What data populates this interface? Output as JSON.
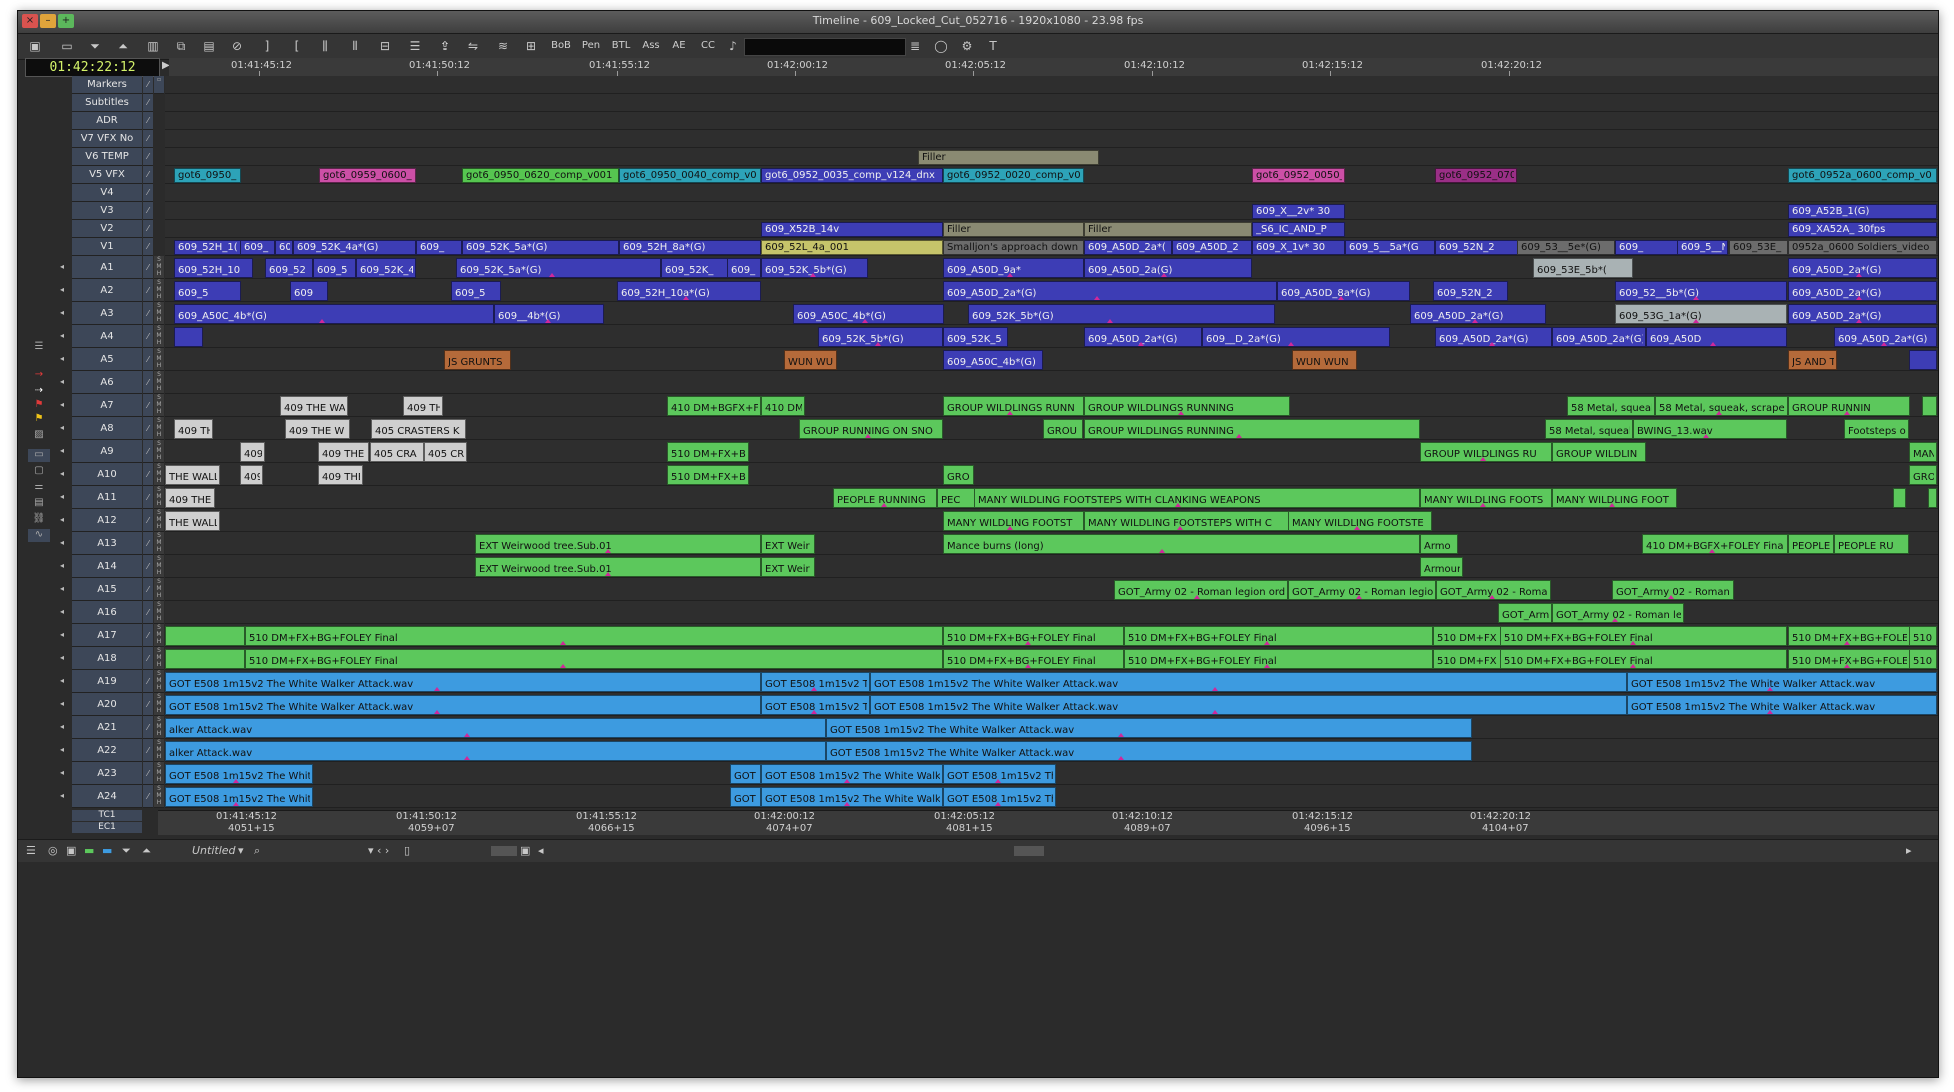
{
  "window": {
    "title": "Timeline - 609_Locked_Cut_052716 - 1920x1080 - 23.98 fps"
  },
  "toolbar": {
    "buttons": [
      "BoB",
      "Pen",
      "BTL",
      "Ass",
      "AE",
      "CC"
    ]
  },
  "timecode": "01:42:22:12",
  "ruler": {
    "labels": [
      "01:41:45:12",
      "01:41:50:12",
      "01:41:55:12",
      "01:42:00:12",
      "01:42:05:12",
      "01:42:10:12",
      "01:42:15:12",
      "01:42:20:12"
    ]
  },
  "bottom_ruler": {
    "tc1_label": "TC1",
    "ec1_label": "EC1",
    "tc1": [
      "01:41:45:12",
      "01:41:50:12",
      "01:41:55:12",
      "01:42:00:12",
      "01:42:05:12",
      "01:42:10:12",
      "01:42:15:12",
      "01:42:20:12"
    ],
    "ec1": [
      "4051+15",
      "4059+07",
      "4066+15",
      "4074+07",
      "4081+15",
      "4089+07",
      "4096+15",
      "4104+07"
    ]
  },
  "tracks": [
    {
      "name": "Markers",
      "clips": []
    },
    {
      "name": "Subtitles",
      "clips": []
    },
    {
      "name": "ADR",
      "clips": []
    },
    {
      "name": "V7 VFX No",
      "clips": []
    },
    {
      "name": "V6 TEMP",
      "clips": [
        {
          "label": "Filler",
          "kind": "cf"
        }
      ]
    },
    {
      "name": "V5 VFX",
      "clips": [
        {
          "label": "got6_0950_",
          "kind": "ct"
        },
        {
          "label": "got6_0959_0600_",
          "kind": "cm"
        },
        {
          "label": "got6_0950_0620_comp_v001",
          "kind": "clg"
        },
        {
          "label": "got6_0950_0040_comp_v0",
          "kind": "ct"
        },
        {
          "label": "got6_0952_0035_comp_v124_dnx",
          "kind": "cv"
        },
        {
          "label": "got6_0952_0020_comp_v0",
          "kind": "ct"
        },
        {
          "label": "got6_0952_0050_",
          "kind": "cm"
        },
        {
          "label": "got6_0952_070",
          "kind": "cp"
        },
        {
          "label": "got6_0952a_0600_comp_v0",
          "kind": "ct"
        }
      ]
    },
    {
      "name": "V4",
      "clips": []
    },
    {
      "name": "V3",
      "clips": [
        {
          "label": "609_X__2v* 30",
          "kind": "cv"
        },
        {
          "label": "609_A52B_1(G)",
          "kind": "cv"
        }
      ]
    },
    {
      "name": "V2",
      "clips": [
        {
          "label": "609_X52B_14v",
          "kind": "cv"
        },
        {
          "label": "Filler",
          "kind": "cf"
        },
        {
          "label": "Filler",
          "kind": "cf"
        },
        {
          "label": "_S6_IC_AND_P",
          "kind": "cv"
        },
        {
          "label": "609_XA52A_ 30fps",
          "kind": "cv"
        }
      ]
    },
    {
      "name": "V1",
      "clips": [
        {
          "label": "609_52H_1(",
          "kind": "cv"
        },
        {
          "label": "609_",
          "kind": "cv"
        },
        {
          "label": "60",
          "kind": "cv"
        },
        {
          "label": "609_52K_4a*(G)",
          "kind": "cv"
        },
        {
          "label": "609_",
          "kind": "cv"
        },
        {
          "label": "609_52K_5a*(G)",
          "kind": "cv"
        },
        {
          "label": "609_52H_8a*(G)",
          "kind": "cv"
        },
        {
          "label": "609_52L_4a_001",
          "kind": "cy"
        },
        {
          "label": "Smalljon's approach down",
          "kind": "cgr"
        },
        {
          "label": "609_A50D_2a*(",
          "kind": "cv"
        },
        {
          "label": "609_A50D_2",
          "kind": "cv"
        },
        {
          "label": "609_X_1v* 30",
          "kind": "cv"
        },
        {
          "label": "609_5__5a*(G",
          "kind": "cv"
        },
        {
          "label": "609_52N_2",
          "kind": "cv"
        },
        {
          "label": "609_53__5e*(G)",
          "kind": "cgr"
        },
        {
          "label": "609_",
          "kind": "cv"
        },
        {
          "label": "609_5__N",
          "kind": "cv"
        },
        {
          "label": "609_53E_",
          "kind": "cgr"
        },
        {
          "label": "0952a_0600 Soldiers_video",
          "kind": "cgr"
        }
      ]
    },
    {
      "name": "A1",
      "clips": [
        {
          "label": "609_52H_10",
          "kind": "cv"
        },
        {
          "label": "609_52",
          "kind": "cv"
        },
        {
          "label": "609_5",
          "kind": "cv"
        },
        {
          "label": "609_52K_4",
          "kind": "cv"
        },
        {
          "label": "609_52K_5a*(G)",
          "kind": "cv"
        },
        {
          "label": "609_52K_",
          "kind": "cv"
        },
        {
          "label": "609_",
          "kind": "cv"
        },
        {
          "label": "609_52K_5b*(G)",
          "kind": "cv"
        },
        {
          "label": "609_A50D_9a*",
          "kind": "cv"
        },
        {
          "label": "609_A50D_2a(G)",
          "kind": "cv"
        },
        {
          "label": "609_53E_5b*(",
          "kind": "cbg"
        },
        {
          "label": "609_A50D_2a*(G)",
          "kind": "cv"
        }
      ]
    },
    {
      "name": "A2",
      "clips": [
        {
          "label": "609_5",
          "kind": "cv"
        },
        {
          "label": "609",
          "kind": "cv"
        },
        {
          "label": "609_5",
          "kind": "cv"
        },
        {
          "label": "609_52H_10a*(G)",
          "kind": "cv"
        },
        {
          "label": "609_A50D_2a*(G)",
          "kind": "cv"
        },
        {
          "label": "609_A50D_8a*(G)",
          "kind": "cv"
        },
        {
          "label": "609_52N_2",
          "kind": "cv"
        },
        {
          "label": "609_52__5b*(G)",
          "kind": "cv"
        },
        {
          "label": "609_A50D_2a*(G)",
          "kind": "cv"
        }
      ]
    },
    {
      "name": "A3",
      "clips": [
        {
          "label": "609_A50C_4b*(G)",
          "kind": "cv"
        },
        {
          "label": "609__4b*(G)",
          "kind": "cv"
        },
        {
          "label": "609_A50C_4b*(G)",
          "kind": "cv"
        },
        {
          "label": "609_52K_5b*(G)",
          "kind": "cv"
        },
        {
          "label": "609_A50D_2a*(G)",
          "kind": "cv"
        },
        {
          "label": "609_53G_1a*(G)",
          "kind": "cbg"
        },
        {
          "label": "609_A50D_2a*(G)",
          "kind": "cv"
        }
      ]
    },
    {
      "name": "A4",
      "clips": [
        {
          "label": "",
          "kind": "cv"
        },
        {
          "label": "609_52K_5b*(G)",
          "kind": "cv"
        },
        {
          "label": "609_52K_5",
          "kind": "cv"
        },
        {
          "label": "609_A50D_2a*(G)",
          "kind": "cv"
        },
        {
          "label": "609__D_2a*(G)",
          "kind": "cv"
        },
        {
          "label": "609_A50D_2a*(G)",
          "kind": "cv"
        },
        {
          "label": "609_A50D_2a*(G)",
          "kind": "cv"
        },
        {
          "label": "609_A50D",
          "kind": "cv"
        },
        {
          "label": "609_A50D_2a*(G)",
          "kind": "cv"
        }
      ]
    },
    {
      "name": "A5",
      "clips": [
        {
          "label": "JS GRUNTS",
          "kind": "co"
        },
        {
          "label": "WUN WU",
          "kind": "co"
        },
        {
          "label": "609_A50C_4b*(G)",
          "kind": "cv"
        },
        {
          "label": "WUN WUN",
          "kind": "co"
        },
        {
          "label": "JS AND T",
          "kind": "co"
        },
        {
          "label": "",
          "kind": "cv"
        }
      ]
    },
    {
      "name": "A6",
      "clips": []
    },
    {
      "name": "A7",
      "clips": [
        {
          "label": "409 THE WA",
          "kind": "cw"
        },
        {
          "label": "409 TH",
          "kind": "cw"
        },
        {
          "label": "410 DM+BGFX+FO",
          "kind": "cg"
        },
        {
          "label": "410 DM",
          "kind": "cg"
        },
        {
          "label": "GROUP WILDLINGS RUNN",
          "kind": "cg"
        },
        {
          "label": "GROUP WILDLINGS RUNNING",
          "kind": "cg"
        },
        {
          "label": "58 Metal, squeal",
          "kind": "cg"
        },
        {
          "label": "58 Metal, squeak, scrape",
          "kind": "cg"
        },
        {
          "label": "GROUP RUNNIN",
          "kind": "cg"
        },
        {
          "label": "",
          "kind": "cg"
        }
      ]
    },
    {
      "name": "A8",
      "clips": [
        {
          "label": "409 TH",
          "kind": "cw"
        },
        {
          "label": "409 THE W",
          "kind": "cw"
        },
        {
          "label": "405 CRASTERS K",
          "kind": "cw"
        },
        {
          "label": "GROUP RUNNING ON SNO",
          "kind": "cg"
        },
        {
          "label": "GROU",
          "kind": "cg"
        },
        {
          "label": "GROUP WILDLINGS RUNNING",
          "kind": "cg"
        },
        {
          "label": "58 Metal, squeak, sc",
          "kind": "cg"
        },
        {
          "label": "BWING_13.wav",
          "kind": "cg"
        },
        {
          "label": "Footsteps o",
          "kind": "cg"
        }
      ]
    },
    {
      "name": "A9",
      "clips": [
        {
          "label": "409",
          "kind": "cw"
        },
        {
          "label": "409 THE",
          "kind": "cw"
        },
        {
          "label": "405 CRA",
          "kind": "cw"
        },
        {
          "label": "405 CR",
          "kind": "cw"
        },
        {
          "label": "510 DM+FX+BG",
          "kind": "cg"
        },
        {
          "label": "GROUP WILDLINGS RU",
          "kind": "cg"
        },
        {
          "label": "GROUP WILDLIN",
          "kind": "cg"
        },
        {
          "label": "MAN",
          "kind": "cg"
        }
      ]
    },
    {
      "name": "A10",
      "clips": [
        {
          "label": "THE WALL",
          "kind": "cw"
        },
        {
          "label": "409",
          "kind": "cw"
        },
        {
          "label": "409 THE",
          "kind": "cw"
        },
        {
          "label": "510 DM+FX+BG",
          "kind": "cg"
        },
        {
          "label": "GRO",
          "kind": "cg"
        },
        {
          "label": "GRO",
          "kind": "cg"
        }
      ]
    },
    {
      "name": "A11",
      "clips": [
        {
          "label": "409 THE",
          "kind": "cw"
        },
        {
          "label": "PEOPLE RUNNING",
          "kind": "cg"
        },
        {
          "label": "PEC",
          "kind": "cg"
        },
        {
          "label": "MANY WILDLING FOOTSTEPS WITH CLANKING WEAPONS",
          "kind": "cg"
        },
        {
          "label": "MANY WILDLING FOOTS",
          "kind": "cg"
        },
        {
          "label": "MANY WILDLING FOOT",
          "kind": "cg"
        },
        {
          "label": "",
          "kind": "cg"
        },
        {
          "label": "",
          "kind": "cg"
        }
      ]
    },
    {
      "name": "A12",
      "clips": [
        {
          "label": "THE WALL",
          "kind": "cw"
        },
        {
          "label": "MANY WILDLING FOOTST",
          "kind": "cg"
        },
        {
          "label": "MANY WILDLING FOOTSTEPS WITH C",
          "kind": "cg"
        },
        {
          "label": "MANY WILDLING FOOTSTE",
          "kind": "cg"
        }
      ]
    },
    {
      "name": "A13",
      "clips": [
        {
          "label": "EXT Weirwood tree.Sub.01",
          "kind": "cg"
        },
        {
          "label": "EXT Weir",
          "kind": "cg"
        },
        {
          "label": "Mance burns (long)",
          "kind": "cg"
        },
        {
          "label": "Armo",
          "kind": "cg"
        },
        {
          "label": "410 DM+BGFX+FOLEY Fina",
          "kind": "cg"
        },
        {
          "label": "PEOPLE",
          "kind": "cg"
        },
        {
          "label": "PEOPLE RU",
          "kind": "cg"
        }
      ]
    },
    {
      "name": "A14",
      "clips": [
        {
          "label": "EXT Weirwood tree.Sub.01",
          "kind": "cg"
        },
        {
          "label": "EXT Weir",
          "kind": "cg"
        },
        {
          "label": "Armour",
          "kind": "cg"
        }
      ]
    },
    {
      "name": "A15",
      "clips": [
        {
          "label": "GOT_Army 02 - Roman legion ord",
          "kind": "cg"
        },
        {
          "label": "GOT_Army 02 - Roman legio",
          "kind": "cg"
        },
        {
          "label": "GOT_Army 02 - Roma",
          "kind": "cg"
        },
        {
          "label": "GOT_Army 02 - Roman",
          "kind": "cg"
        }
      ]
    },
    {
      "name": "A16",
      "clips": [
        {
          "label": "GOT_Arm",
          "kind": "cg"
        },
        {
          "label": "GOT_Army 02 - Roman le",
          "kind": "cg"
        }
      ]
    },
    {
      "name": "A17",
      "clips": [
        {
          "label": "",
          "kind": "cg"
        },
        {
          "label": "510 DM+FX+BG+FOLEY Final",
          "kind": "cg"
        },
        {
          "label": "510 DM+FX+BG+FOLEY Final",
          "kind": "cg"
        },
        {
          "label": "510 DM+FX+BG+FOLEY Final",
          "kind": "cg"
        },
        {
          "label": "510 DM+FX",
          "kind": "cg"
        },
        {
          "label": "510 DM+FX+BG+FOLEY Final",
          "kind": "cg"
        },
        {
          "label": "510 DM+FX+BG+FOLE",
          "kind": "cg"
        },
        {
          "label": "510",
          "kind": "cg"
        }
      ]
    },
    {
      "name": "A18",
      "clips": [
        {
          "label": "",
          "kind": "cg"
        },
        {
          "label": "510 DM+FX+BG+FOLEY Final",
          "kind": "cg"
        },
        {
          "label": "510 DM+FX+BG+FOLEY Final",
          "kind": "cg"
        },
        {
          "label": "510 DM+FX+BG+FOLEY Final",
          "kind": "cg"
        },
        {
          "label": "510 DM+FX",
          "kind": "cg"
        },
        {
          "label": "510 DM+FX+BG+FOLEY Final",
          "kind": "cg"
        },
        {
          "label": "510 DM+FX+BG+FOLE",
          "kind": "cg"
        },
        {
          "label": "510",
          "kind": "cg"
        }
      ]
    },
    {
      "name": "A19",
      "clips": [
        {
          "label": "GOT E508 1m15v2 The White Walker Attack.wav",
          "kind": "cb"
        },
        {
          "label": "GOT E508 1m15v2 T",
          "kind": "cb"
        },
        {
          "label": "GOT E508 1m15v2 The White Walker Attack.wav",
          "kind": "cb"
        },
        {
          "label": "GOT E508 1m15v2 The White Walker Attack.wav",
          "kind": "cb"
        }
      ]
    },
    {
      "name": "A20",
      "clips": [
        {
          "label": "GOT E508 1m15v2 The White Walker Attack.wav",
          "kind": "cb"
        },
        {
          "label": "GOT E508 1m15v2 T",
          "kind": "cb"
        },
        {
          "label": "GOT E508 1m15v2 The White Walker Attack.wav",
          "kind": "cb"
        },
        {
          "label": "GOT E508 1m15v2 The White Walker Attack.wav",
          "kind": "cb"
        }
      ]
    },
    {
      "name": "A21",
      "clips": [
        {
          "label": "alker Attack.wav",
          "kind": "cb"
        },
        {
          "label": "GOT E508 1m15v2 The White Walker Attack.wav",
          "kind": "cb"
        }
      ]
    },
    {
      "name": "A22",
      "clips": [
        {
          "label": "alker Attack.wav",
          "kind": "cb"
        },
        {
          "label": "GOT E508 1m15v2 The White Walker Attack.wav",
          "kind": "cb"
        }
      ]
    },
    {
      "name": "A23",
      "clips": [
        {
          "label": "GOT E508 1m15v2 The White",
          "kind": "cb"
        },
        {
          "label": "GOT",
          "kind": "cb"
        },
        {
          "label": "GOT E508 1m15v2 The White Walk",
          "kind": "cb"
        },
        {
          "label": "GOT E508 1m15v2 Th",
          "kind": "cb"
        }
      ]
    },
    {
      "name": "A24",
      "clips": [
        {
          "label": "GOT E508 1m15v2 The White",
          "kind": "cb"
        },
        {
          "label": "GOT",
          "kind": "cb"
        },
        {
          "label": "GOT E508 1m15v2 The White Walk",
          "kind": "cb"
        },
        {
          "label": "GOT E508 1m15v2 Th",
          "kind": "cb"
        }
      ]
    }
  ],
  "bottombar": {
    "sequence_name": "Untitled"
  }
}
